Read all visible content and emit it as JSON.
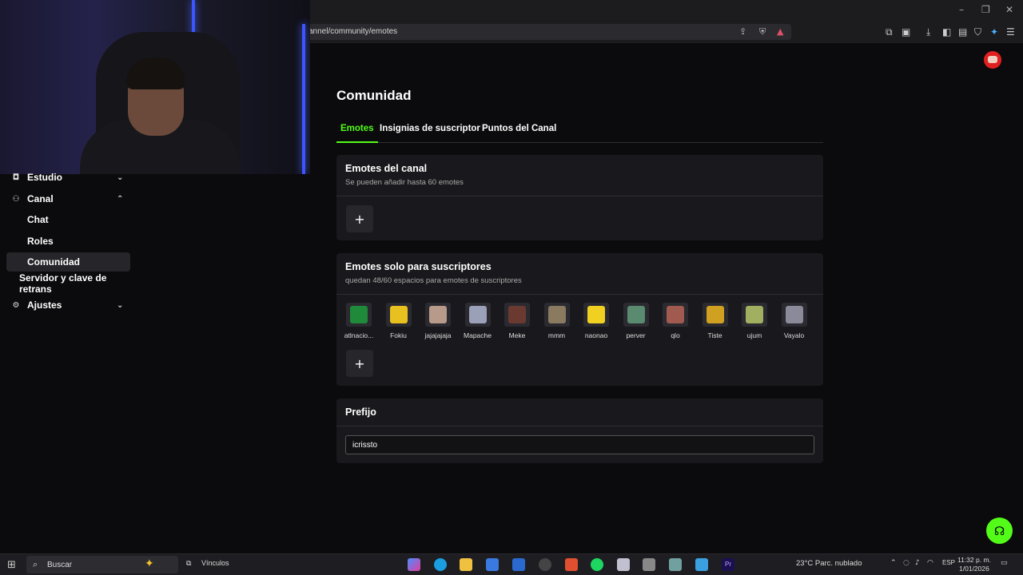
{
  "browser": {
    "url": "annel/community/emotes",
    "min": "–",
    "restore": "❐",
    "close": "✕"
  },
  "sidebar": {
    "items": [
      {
        "label": "Estudio",
        "icon": "studio-icon"
      },
      {
        "label": "Canal",
        "icon": "channel-icon"
      },
      {
        "label": "Chat"
      },
      {
        "label": "Roles"
      },
      {
        "label": "Comunidad"
      },
      {
        "label": "Servidor y clave de retrans"
      },
      {
        "label": "Ajustes",
        "icon": "gear-icon"
      }
    ]
  },
  "page": {
    "title": "Comunidad",
    "tabs": [
      {
        "label": "Emotes",
        "active": true
      },
      {
        "label": "Insignias de suscriptor",
        "active": false
      },
      {
        "label": "Puntos del Canal",
        "active": false
      }
    ]
  },
  "channel_emotes": {
    "title": "Emotes del canal",
    "subtitle": "Se pueden añadir hasta 60 emotes",
    "add_label": "+"
  },
  "sub_emotes": {
    "title": "Emotes solo para suscriptores",
    "subtitle": "quedan 48/60 espacios para emotes de suscriptores",
    "add_label": "+",
    "emotes": [
      {
        "name": "atlnacio...",
        "color": "#1f8a3a"
      },
      {
        "name": "Fokiu",
        "color": "#e8c020"
      },
      {
        "name": "jajajajaja",
        "color": "#b89a8a"
      },
      {
        "name": "Mapache",
        "color": "#9aa0b8"
      },
      {
        "name": "Meke",
        "color": "#6a3a30"
      },
      {
        "name": "mmm",
        "color": "#8a7a60"
      },
      {
        "name": "naonao",
        "color": "#f0d020"
      },
      {
        "name": "perver",
        "color": "#5a8a70"
      },
      {
        "name": "qlo",
        "color": "#a05a50"
      },
      {
        "name": "Tiste",
        "color": "#d0a020"
      },
      {
        "name": "ujum",
        "color": "#a0b060"
      },
      {
        "name": "Vayalo",
        "color": "#8a8a9a"
      }
    ]
  },
  "prefix": {
    "title": "Prefijo",
    "value": "icrissto"
  },
  "taskbar": {
    "search_placeholder": "Buscar",
    "links_label": "Vínculos",
    "weather": "23°C  Parc. nublado",
    "lang": "ESP",
    "time": "11:32 p. m.",
    "date": "1/01/2026"
  },
  "colors": {
    "accent": "#53fc18",
    "background": "#0b0b0d",
    "card": "#19191d"
  }
}
